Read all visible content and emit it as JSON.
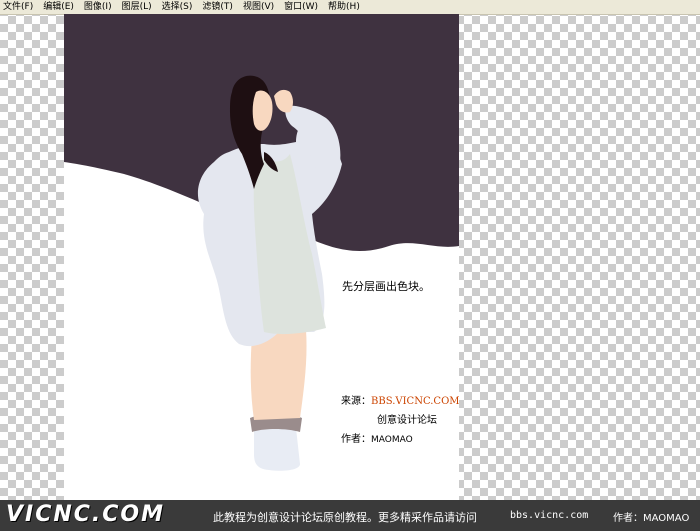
{
  "menu": [
    "文件(F)",
    "编辑(E)",
    "图像(I)",
    "图层(L)",
    "选择(S)",
    "滤镜(T)",
    "视图(V)",
    "窗口(W)",
    "帮助(H)"
  ],
  "canvas": {
    "caption": "先分层画出色块。",
    "source_label": "来源：",
    "source_link": "BBS.VICNC.COM",
    "forum_name": "创意设计论坛",
    "author_label": "作者：",
    "author_name": "MAOMAO",
    "colors": {
      "background_dark": "#3f3240",
      "coat": "#e4e7ef",
      "dress": "#dde3dd",
      "skin": "#f8d8c0",
      "hair": "#1e0f12",
      "boot_fur": "#9a8c8c",
      "boot": "#e8ecf4"
    }
  },
  "footer": {
    "logo": "VICNC.COM",
    "text": "此教程为创意设计论坛原创教程。更多精采作品请访问",
    "url": "bbs.vicnc.com",
    "author": "作者：MAOMAO"
  }
}
